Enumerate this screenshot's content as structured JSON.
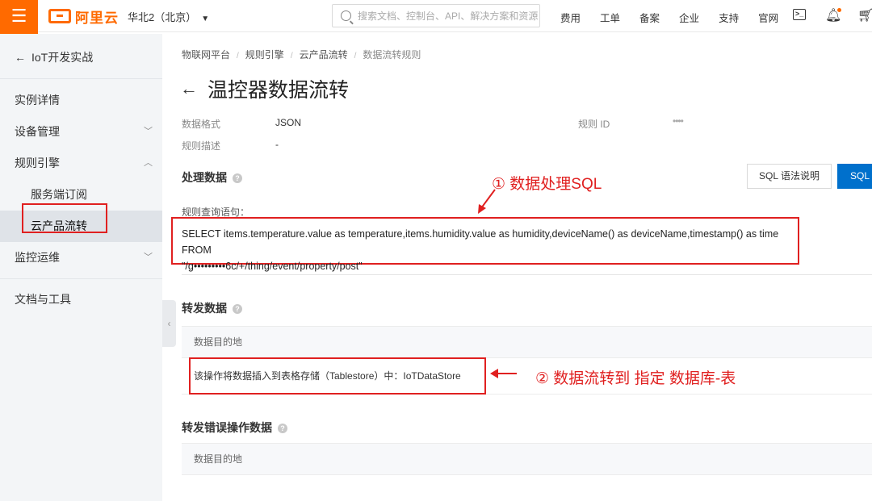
{
  "topbar": {
    "menu_icon": "hamburger-icon",
    "logo_text": "阿里云",
    "region": "华北2（北京）",
    "search_placeholder": "搜索文档、控制台、API、解决方案和资源",
    "nav": [
      "费用",
      "工单",
      "备案",
      "企业",
      "支持",
      "官网"
    ],
    "icons": [
      "terminal-icon",
      "bell-icon",
      "cart-icon"
    ]
  },
  "sidebar": {
    "back_label": "IoT开发实战",
    "items": [
      {
        "label": "实例详情",
        "chevron": ""
      },
      {
        "label": "设备管理",
        "chevron": "down"
      },
      {
        "label": "规则引擎",
        "chevron": "up"
      },
      {
        "label": "服务端订阅",
        "sub": true
      },
      {
        "label": "云产品流转",
        "sub": true,
        "active": true
      },
      {
        "label": "监控运维",
        "chevron": "down"
      },
      {
        "label": "文档与工具",
        "chevron": ""
      }
    ]
  },
  "breadcrumb": [
    "物联网平台",
    "规则引擎",
    "云产品流转",
    "数据流转规则"
  ],
  "page": {
    "title": "温控器数据流转",
    "data_format_label": "数据格式",
    "data_format_value": "JSON",
    "rule_id_label": "规则 ID",
    "rule_id_value": "••••",
    "rule_desc_label": "规则描述",
    "rule_desc_value": "-"
  },
  "process": {
    "title": "处理数据",
    "sql_help_button": "SQL 语法说明",
    "sql_edit_button": "SQL",
    "query_label": "规则查询语句：",
    "sql_line1": "SELECT items.temperature.value as temperature,items.humidity.value as humidity,deviceName() as deviceName,timestamp() as time FROM",
    "sql_line2": "\"/g•••••••••6c/+/thing/event/property/post\""
  },
  "forward": {
    "title": "转发数据",
    "col_header": "数据目的地",
    "destination": "该操作将数据插入到表格存储（Tablestore）中：IoTDataStore"
  },
  "error_forward": {
    "title": "转发错误操作数据",
    "col_header": "数据目的地"
  },
  "annotations": {
    "note1": "① 数据处理SQL",
    "note2": "② 数据流转到 指定 数据库-表",
    "color": "#e02020"
  },
  "colors": {
    "brand": "#ff6a00",
    "primary": "#0070cc"
  }
}
